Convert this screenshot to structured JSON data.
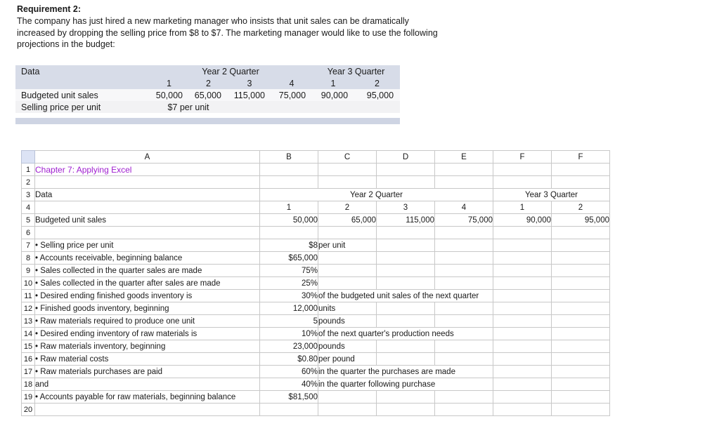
{
  "requirement": {
    "heading": "Requirement 2:",
    "body": "The company has just hired a new marketing manager who insists that unit sales can be dramatically increased by dropping the selling price from $8 to $7. The marketing manager would like to use the following projections in the budget:"
  },
  "data_table": {
    "title": "Data",
    "group_year2": "Year 2 Quarter",
    "group_year3": "Year 3 Quarter",
    "quarter_headers": [
      "1",
      "2",
      "3",
      "4",
      "1",
      "2"
    ],
    "rows": [
      {
        "label": "Budgeted unit sales",
        "values": [
          "50,000",
          "65,000",
          "115,000",
          "75,000",
          "90,000",
          "95,000"
        ]
      },
      {
        "label": "Selling price per unit",
        "value": "$7 per unit"
      }
    ]
  },
  "spreadsheet": {
    "column_headers": [
      "A",
      "B",
      "C",
      "D",
      "E",
      "F",
      "F"
    ],
    "row_numbers": [
      "1",
      "2",
      "3",
      "4",
      "5",
      "6",
      "7",
      "8",
      "9",
      "10",
      "11",
      "12",
      "13",
      "14",
      "15",
      "16",
      "17",
      "18",
      "19",
      "20"
    ],
    "title": "Chapter 7: Applying Excel",
    "title_color": "#a020d0",
    "data_label": "Data",
    "group_year2": "Year 2 Quarter",
    "group_year3": "Year 3 Quarter",
    "quarter_headers": [
      "1",
      "2",
      "3",
      "4",
      "1",
      "2"
    ],
    "budgeted_unit_sales": {
      "label": "Budgeted unit sales",
      "values": [
        "50,000",
        "65,000",
        "115,000",
        "75,000",
        "90,000",
        "95,000"
      ]
    },
    "items": [
      {
        "row": "7",
        "label": "• Selling price per unit",
        "value": "$8",
        "note": "per unit",
        "span": false
      },
      {
        "row": "8",
        "label": "• Accounts receivable, beginning balance",
        "value": "$65,000",
        "note": "",
        "span": false
      },
      {
        "row": "9",
        "label": "• Sales collected in the quarter sales are made",
        "value": "75%",
        "note": "",
        "span": false
      },
      {
        "row": "10",
        "label": "• Sales collected in the quarter after sales are made",
        "value": "25%",
        "note": "",
        "span": false
      },
      {
        "row": "11",
        "label": "• Desired ending finished goods inventory is",
        "value": "30%",
        "note": "of the budgeted unit sales of the next quarter",
        "span": true
      },
      {
        "row": "12",
        "label": "• Finished goods inventory, beginning",
        "value": "12,000",
        "note": "units",
        "span": false
      },
      {
        "row": "13",
        "label": "• Raw materials required to produce one unit",
        "value": "5",
        "note": "pounds",
        "span": false
      },
      {
        "row": "14",
        "label": "• Desired ending inventory of raw materials is",
        "value": "10%",
        "note": "of the next quarter's production needs",
        "span": true
      },
      {
        "row": "15",
        "label": "• Raw materials inventory, beginning",
        "value": "23,000",
        "note": "pounds",
        "span": false
      },
      {
        "row": "16",
        "label": "• Raw material costs",
        "value": "$0.80",
        "note": "per pound",
        "span": false
      },
      {
        "row": "17",
        "label": "• Raw materials purchases are paid",
        "value": "60%",
        "note": "in the quarter the purchases are made",
        "span": true
      },
      {
        "row": "18",
        "label": "    and",
        "value": "40%",
        "note": "in the quarter following purchase",
        "span": true
      },
      {
        "row": "19",
        "label": "• Accounts payable for raw materials, beginning balance",
        "value": "$81,500",
        "note": "",
        "span": false
      },
      {
        "row": "20",
        "label": "",
        "value": "",
        "note": "",
        "span": false
      }
    ]
  }
}
